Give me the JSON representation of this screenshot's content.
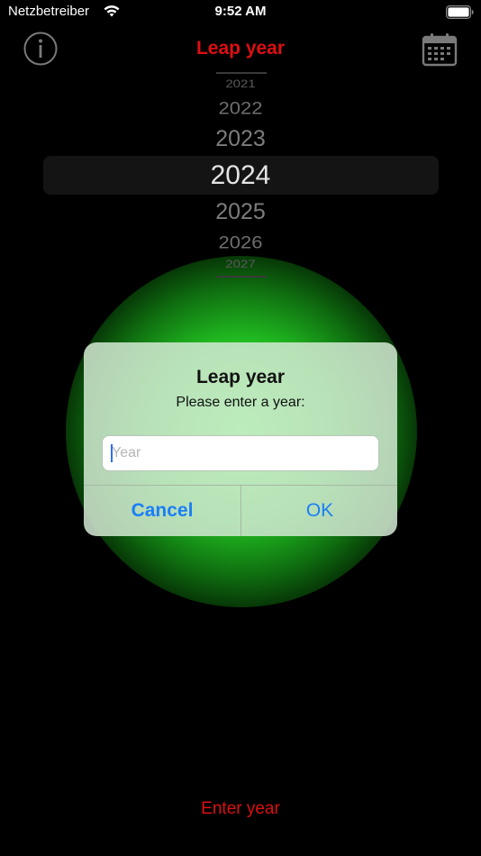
{
  "status_bar": {
    "carrier": "Netzbetreiber",
    "time": "9:52 AM"
  },
  "nav": {
    "title": "Leap year",
    "left_icon": "info-icon",
    "right_icon": "calendar-icon"
  },
  "picker": {
    "years": [
      "2021",
      "2022",
      "2023",
      "2024",
      "2025",
      "2026",
      "2027"
    ],
    "selected": "2024"
  },
  "alert": {
    "title": "Leap year",
    "message": "Please enter a year:",
    "input_placeholder": "Year",
    "input_value": "",
    "cancel_label": "Cancel",
    "ok_label": "OK"
  },
  "footer": {
    "enter_year_label": "Enter year"
  },
  "colors": {
    "accent_red": "#dd0f12",
    "button_blue": "#1a7ff6",
    "glow_green": "#39ff3a"
  }
}
